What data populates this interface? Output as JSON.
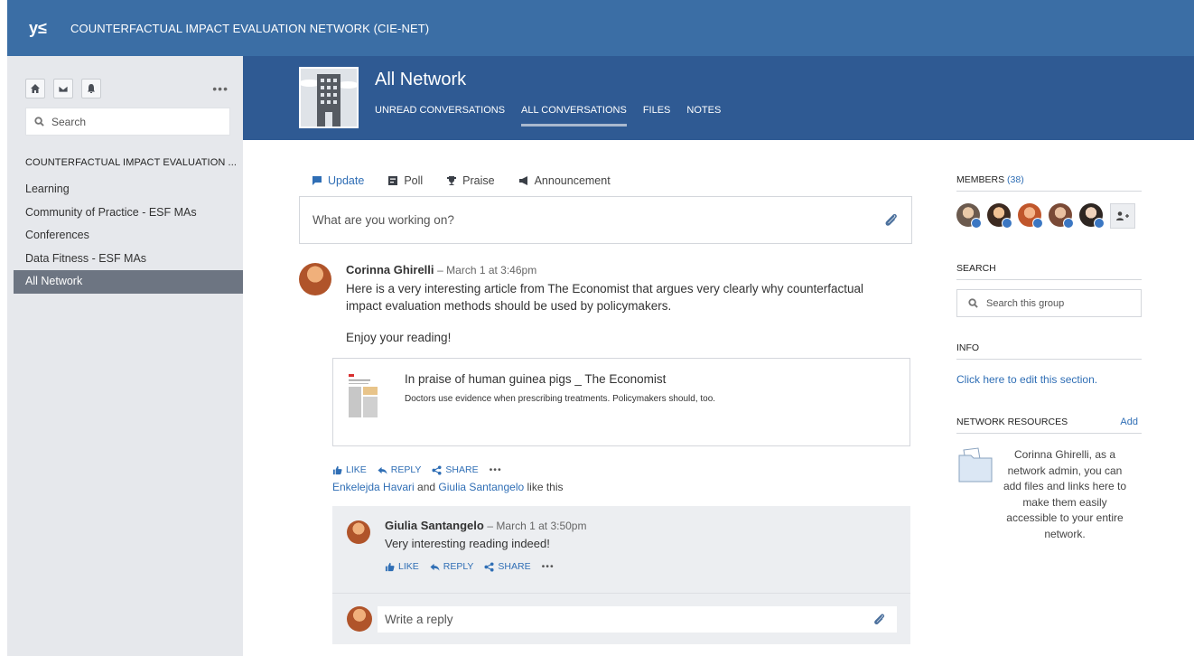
{
  "topbar": {
    "logo_text": "y≤",
    "network_title": "COUNTERFACTUAL IMPACT EVALUATION NETWORK (CIE-NET)"
  },
  "sidebar": {
    "buttons": [
      "home-icon",
      "mail-icon",
      "bell-icon"
    ],
    "more": "•••",
    "search_placeholder": "Search",
    "group_title": "COUNTERFACTUAL IMPACT EVALUATION ...",
    "items": [
      {
        "label": "Learning"
      },
      {
        "label": "Community of Practice - ESF MAs"
      },
      {
        "label": "Conferences"
      },
      {
        "label": "Data Fitness - ESF MAs"
      },
      {
        "label": "All Network",
        "active": true
      }
    ]
  },
  "group": {
    "name": "All Network",
    "tabs": [
      {
        "label": "UNREAD CONVERSATIONS"
      },
      {
        "label": "ALL CONVERSATIONS",
        "active": true
      },
      {
        "label": "FILES"
      },
      {
        "label": "NOTES"
      }
    ]
  },
  "publisher": {
    "tabs": [
      {
        "label": "Update",
        "icon": "speech-bubble-icon",
        "active": true
      },
      {
        "label": "Poll",
        "icon": "poll-icon"
      },
      {
        "label": "Praise",
        "icon": "trophy-icon"
      },
      {
        "label": "Announcement",
        "icon": "megaphone-icon"
      }
    ],
    "placeholder": "What are you working on?"
  },
  "post": {
    "author": "Corinna Ghirelli",
    "time": "– March 1 at 3:46pm",
    "text": "Here is a very interesting article from The Economist that argues very clearly why counterfactual impact evaluation methods should be used by policymakers.",
    "text2": "Enjoy your reading!",
    "attachment": {
      "title": "In praise of human guinea pigs _ The Economist",
      "description": "Doctors use evidence when prescribing treatments. Policymakers should, too."
    },
    "actions": {
      "like": "LIKE",
      "reply": "REPLY",
      "share": "SHARE",
      "more": "•••"
    },
    "likes": {
      "user1": "Enkelejda Havari",
      "and": " and ",
      "user2": "Giulia Santangelo",
      "suffix": " like this"
    }
  },
  "reply": {
    "author": "Giulia Santangelo",
    "time": "– March 1 at 3:50pm",
    "text": "Very interesting reading indeed!",
    "actions": {
      "like": "LIKE",
      "reply": "REPLY",
      "share": "SHARE",
      "more": "•••"
    }
  },
  "write_reply": {
    "placeholder": "Write a reply"
  },
  "right": {
    "members_label": "MEMBERS",
    "members_count": "(38)",
    "search_label": "SEARCH",
    "search_placeholder": "Search this group",
    "info_label": "INFO",
    "info_link": "Click here to edit this section.",
    "resources_label": "NETWORK RESOURCES",
    "resources_add": "Add",
    "resources_text": "Corinna Ghirelli, as a network admin, you can add files and links here to make them easily accessible to your entire network."
  },
  "colors": {
    "topbar": "#3b6ea5",
    "group_header": "#2f5a93",
    "link": "#2f6eb5",
    "sidebar_bg": "#e6e8ec",
    "sidebar_active": "#6d7582"
  }
}
